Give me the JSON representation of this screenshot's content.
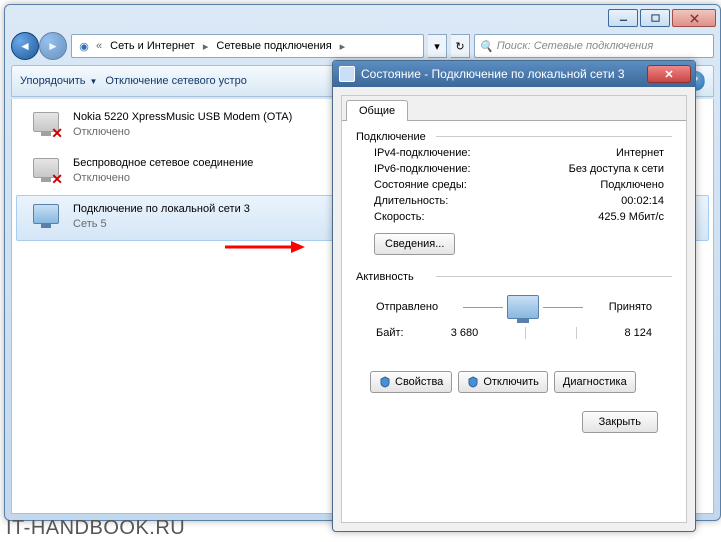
{
  "breadcrumb": {
    "seg1": "Сеть и Интернет",
    "seg2": "Сетевые подключения"
  },
  "search": {
    "placeholder": "Поиск: Сетевые подключения"
  },
  "toolbar": {
    "organize": "Упорядочить",
    "disable": "Отключение сетевого устро"
  },
  "connections": [
    {
      "name": "Nokia 5220 XpressMusic USB Modem (OTA)",
      "sub": "Отключено"
    },
    {
      "name": "Беспроводное сетевое соединение",
      "sub": "Отключено"
    },
    {
      "name": "Подключение по локальной сети 3",
      "sub": "Сеть 5"
    }
  ],
  "dlg": {
    "title": "Состояние - Подключение по локальной сети 3",
    "tab": "Общие",
    "group_conn": "Подключение",
    "kv": {
      "ipv4_k": "IPv4-подключение:",
      "ipv4_v": "Интернет",
      "ipv6_k": "IPv6-подключение:",
      "ipv6_v": "Без доступа к сети",
      "media_k": "Состояние среды:",
      "media_v": "Подключено",
      "dur_k": "Длительность:",
      "dur_v": "00:02:14",
      "speed_k": "Скорость:",
      "speed_v": "425.9 Мбит/с"
    },
    "details_btn": "Сведения...",
    "group_act": "Активность",
    "sent": "Отправлено",
    "recv": "Принято",
    "bytes_label": "Байт:",
    "bytes_sent": "3 680",
    "bytes_recv": "8 124",
    "props_btn": "Свойства",
    "disable_btn": "Отключить",
    "diag_btn": "Диагностика",
    "close_btn": "Закрыть"
  },
  "watermark": "IT-HANDBOOK.RU"
}
